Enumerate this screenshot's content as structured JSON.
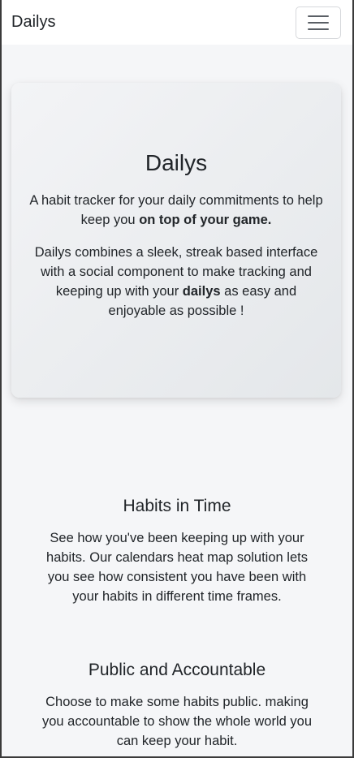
{
  "navbar": {
    "brand": "Dailys",
    "toggler_icon": "hamburger-menu-icon"
  },
  "hero": {
    "title": "Dailys",
    "tagline_prefix": "A habit tracker for your daily commitments to help keep you ",
    "tagline_bold": "on top of your game.",
    "description_prefix": "Dailys combines a sleek, streak based interface with a social component to make tracking and keeping up with your ",
    "description_bold": "dailys",
    "description_suffix": " as easy and enjoyable as possible !"
  },
  "features": [
    {
      "title": "Habits in Time",
      "text": "See how you've been keeping up with your habits. Our calendars heat map solution lets you see how consistent you have been with your habits in different time frames."
    },
    {
      "title": "Public and Accountable",
      "text": "Choose to make some habits public. making you accountable to show the whole world you can keep your habit."
    }
  ]
}
